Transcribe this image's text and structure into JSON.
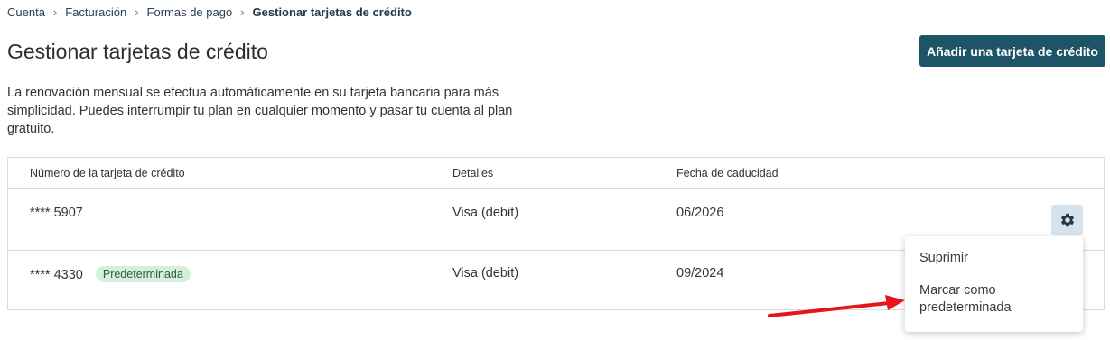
{
  "breadcrumb": {
    "items": [
      "Cuenta",
      "Facturación",
      "Formas de pago"
    ],
    "current": "Gestionar tarjetas de crédito"
  },
  "page": {
    "title": "Gestionar tarjetas de crédito",
    "add_card_button": "Añadir una tarjeta de crédito",
    "description": "La renovación mensual se efectua automáticamente en su tarjeta bancaria para más simplicidad. Puedes interrumpir tu plan en cualquier momento y pasar tu cuenta al plan gratuito."
  },
  "table": {
    "headers": {
      "number": "Número de la tarjeta de crédito",
      "details": "Detalles",
      "expiry": "Fecha de caducidad"
    },
    "rows": [
      {
        "number": "**** 5907",
        "badge": "",
        "details": "Visa (debit)",
        "expiry": "06/2026"
      },
      {
        "number": "**** 4330",
        "badge": "Predeterminada",
        "details": "Visa (debit)",
        "expiry": "09/2024"
      }
    ]
  },
  "context_menu": {
    "items": [
      "Suprimir",
      "Marcar como predeterminada"
    ]
  },
  "icons": {
    "gear": "gear-icon",
    "separator": "chevron-right-icon",
    "annotation": "red-arrow"
  },
  "colors": {
    "primary_button": "#1e5566",
    "gear_button_bg": "#d6e3ec",
    "badge_bg": "#d4efdc",
    "annotation_arrow": "#e8141b"
  }
}
